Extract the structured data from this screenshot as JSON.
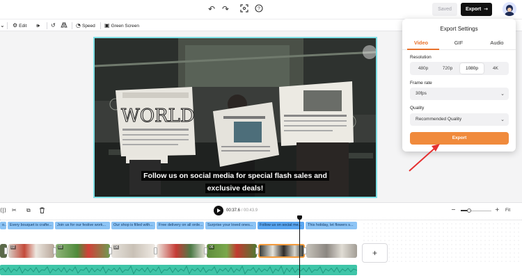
{
  "topbar": {
    "saved_label": "Saved",
    "export_label": "Export",
    "icons": [
      "undo-icon",
      "redo-icon",
      "screenshot-icon",
      "help-icon"
    ]
  },
  "toolbar": {
    "edit_label": "Edit",
    "speed_label": "Speed",
    "green_screen_label": "Green Screen"
  },
  "canvas": {
    "caption_lines": [
      "Follow us on social media for special flash sales and",
      "exclusive deals!"
    ],
    "newspaper_text": "WORLD"
  },
  "export_panel": {
    "title": "Export Settings",
    "tabs": [
      {
        "label": "Video",
        "active": true
      },
      {
        "label": "GIF",
        "active": false
      },
      {
        "label": "Audio",
        "active": false
      }
    ],
    "resolution_label": "Resolution",
    "resolutions": [
      {
        "label": "480p",
        "selected": false
      },
      {
        "label": "720p",
        "selected": false
      },
      {
        "label": "1080p",
        "selected": true
      },
      {
        "label": "4K",
        "selected": false
      }
    ],
    "frame_rate_label": "Frame rate",
    "frame_rate_value": "30fps",
    "quality_label": "Quality",
    "quality_value": "Recommended Quality",
    "export_button": "Export",
    "accent_color": "#f08a3c"
  },
  "timeline": {
    "current_time": "00:37.6",
    "total_time": "00:43.9",
    "fit_label": "Fit",
    "captions": [
      "o...",
      "Every bouquet is crafte...",
      "Join us for our festive work...",
      "Our shop is filled with...",
      "Free delivery on all orde...",
      "Surprise your loved ones...",
      "Follow us on social me...",
      "This holiday, let flowers s..."
    ],
    "clips": [
      "",
      "02",
      "03",
      "04",
      "",
      "06",
      "",
      ""
    ],
    "add_clip_label": "+"
  }
}
